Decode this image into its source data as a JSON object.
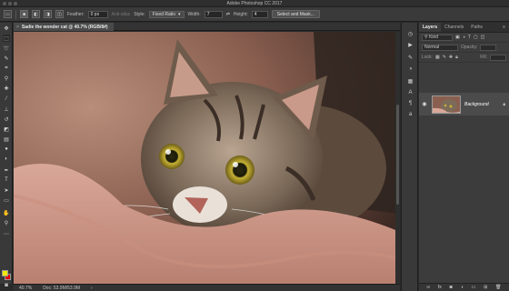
{
  "app": {
    "title": "Adobe Photoshop CC 2017"
  },
  "options": {
    "feather_label": "Feather:",
    "feather_value": "0 px",
    "antialias_label": "Anti-alias",
    "style_label": "Style:",
    "style_value": "Fixed Ratio",
    "width_label": "Width:",
    "width_value": "7",
    "height_label": "Height:",
    "height_value": "4",
    "select_mask_label": "Select and Mask..."
  },
  "document": {
    "tab_title": "Sadie the wonder cat @ 40.7% (RGB/8#)",
    "close_glyph": "×"
  },
  "status": {
    "zoom": "40.7%",
    "doc_info": "Doc: 53.9M/53.9M",
    "arrow": "›"
  },
  "layers_panel": {
    "tabs": [
      {
        "label": "Layers"
      },
      {
        "label": "Channels"
      },
      {
        "label": "Paths"
      }
    ],
    "kind_placeholder": "Kind",
    "blend_mode": "Normal",
    "opacity_label": "Opacity:",
    "lock_label": "Lock:",
    "fill_label": "Fill:",
    "layer_name": "Background"
  },
  "colors": {
    "foreground": "#f3e900",
    "background": "#e00000",
    "ui_dark": "#2b2b2b"
  },
  "icons": {
    "tools": [
      "move-icon",
      "marquee-icon",
      "lasso-icon",
      "quick-select-icon",
      "crop-icon",
      "eyedropper-icon",
      "healing-icon",
      "brush-icon",
      "stamp-icon",
      "history-brush-icon",
      "eraser-icon",
      "gradient-icon",
      "blur-icon",
      "dodge-icon",
      "pen-icon",
      "type-icon",
      "path-select-icon",
      "shape-icon",
      "hand-icon",
      "zoom-icon"
    ],
    "mini": [
      "history-icon",
      "play-icon",
      "brush-settings-icon",
      "adjustments-icon",
      "styles-icon",
      "character-icon",
      "paragraph-icon",
      "glyphs-icon"
    ]
  }
}
